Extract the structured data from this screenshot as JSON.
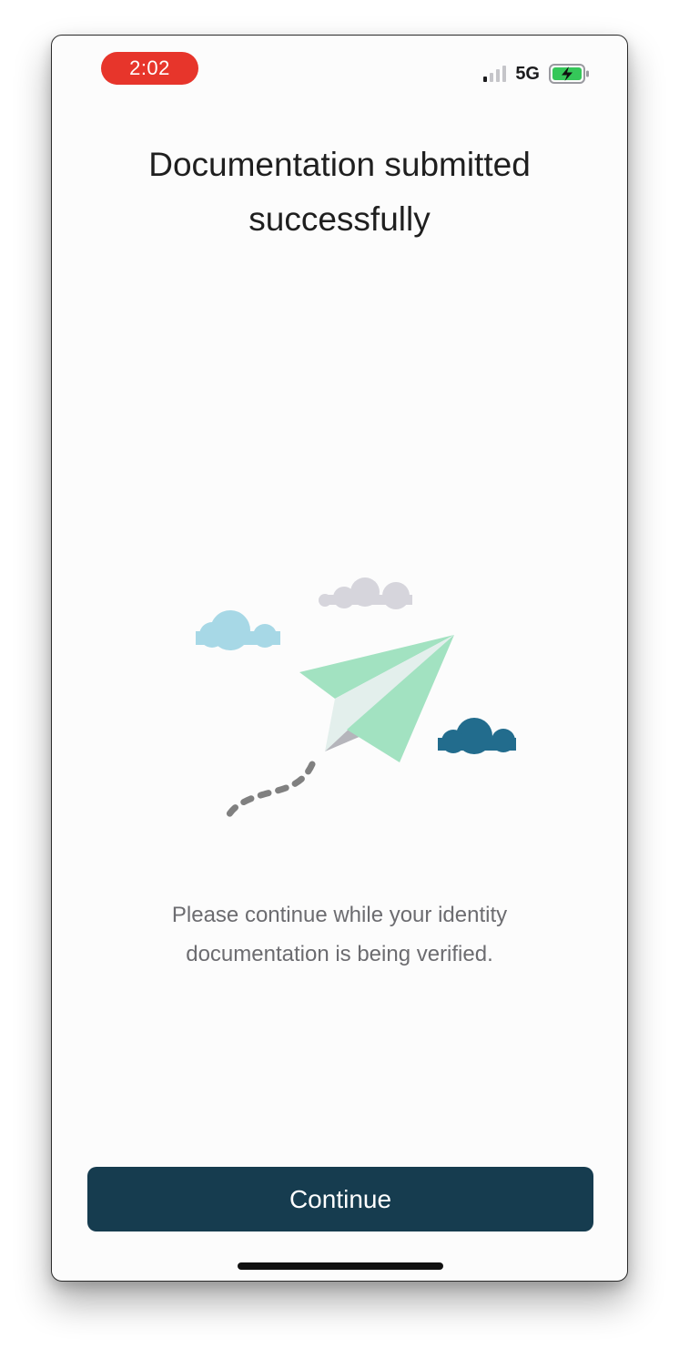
{
  "status_bar": {
    "time": "2:02",
    "network": "5G",
    "signal_bars_active": 1,
    "signal_bars_total": 4,
    "battery_state": "charging",
    "icons": [
      "signal-icon",
      "battery-charging-icon"
    ]
  },
  "main": {
    "title": "Documentation submitted successfully",
    "message": "Please continue while your identity documentation is being verified.",
    "illustration": "paper-plane-with-clouds"
  },
  "actions": {
    "continue_label": "Continue"
  },
  "colors": {
    "time_pill": "#e7352b",
    "button": "#163c4f",
    "plane": "#a4e2c1",
    "cloud_light_blue": "#a7d8e6",
    "cloud_gray": "#d6d5dc",
    "cloud_dark_blue": "#226c8d",
    "battery_green": "#35c759"
  }
}
